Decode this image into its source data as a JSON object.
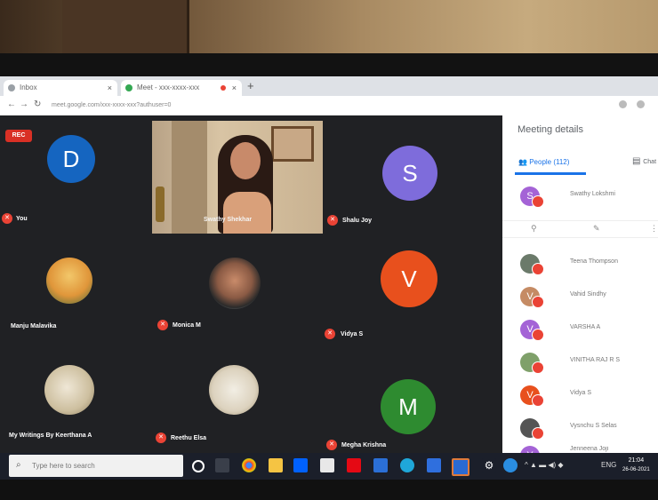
{
  "browser": {
    "tabs": [
      {
        "label": "Inbox"
      },
      {
        "label": "Meet - xxx-xxxx-xxx"
      }
    ],
    "new_tab": "+",
    "url": "meet.google.com/xxx-xxxx-xxx?authuser=0"
  },
  "meeting": {
    "rec_badge": "REC",
    "tiles": [
      {
        "name": "You",
        "initial": "D",
        "color": "#1565c0"
      },
      {
        "name": "Swathy Shekhar",
        "initial": "",
        "color": ""
      },
      {
        "name": "Shalu Joy",
        "initial": "S",
        "color": "#7e6cdb"
      },
      {
        "name": "Manju Malavika",
        "initial": "",
        "color": ""
      },
      {
        "name": "Monica M",
        "initial": "",
        "color": ""
      },
      {
        "name": "Vidya S",
        "initial": "V",
        "color": "#e8501d"
      },
      {
        "name": "My Writings By Keerthana A",
        "initial": "",
        "color": ""
      },
      {
        "name": "Reethu Elsa",
        "initial": "",
        "color": ""
      },
      {
        "name": "Megha Krishna",
        "initial": "M",
        "color": "#2e8b30"
      }
    ]
  },
  "panel": {
    "title": "Meeting details",
    "people_tab": "People (112)",
    "chat_tab": "Chat",
    "people": [
      {
        "name": "Swathy Lokshmi",
        "initial": "S",
        "color": "#a463d6"
      },
      {
        "name": "Teena Thompson",
        "initial": "",
        "color": "#6b7a6a"
      },
      {
        "name": "Vahid Sindhy",
        "initial": "V",
        "color": "#c58b64"
      },
      {
        "name": "VARSHA A",
        "initial": "V",
        "color": "#a463d6"
      },
      {
        "name": "VINITHA RAJ R S",
        "initial": "",
        "color": "#7fa06a"
      },
      {
        "name": "Vidya S",
        "initial": "V",
        "color": "#e8501d"
      },
      {
        "name": "Vysnchu S Selas",
        "initial": "",
        "color": "#555"
      },
      {
        "name": "Jenneena Joji",
        "initial": "Y",
        "color": "#a463d6"
      }
    ]
  },
  "taskbar": {
    "search_placeholder": "Type here to search",
    "language": "ENG",
    "time": "21:04",
    "date": "26-06-2021"
  }
}
